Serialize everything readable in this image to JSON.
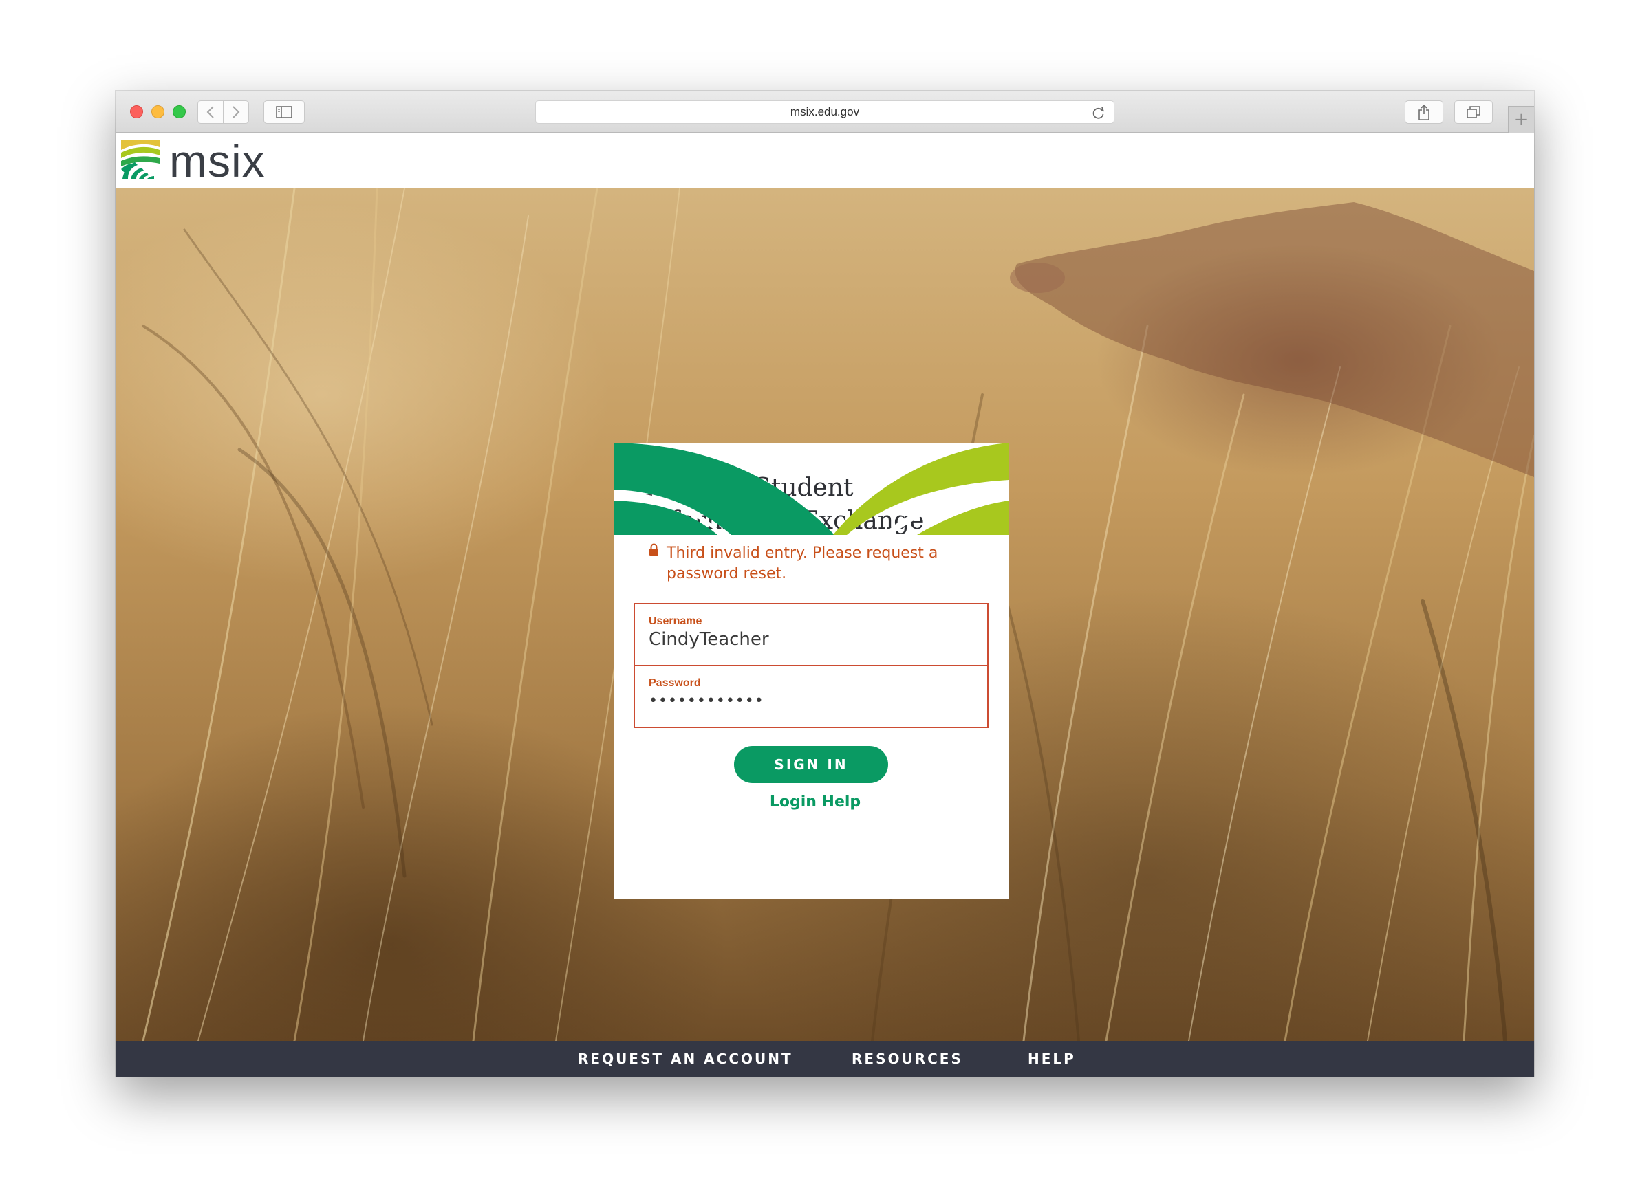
{
  "browser": {
    "url": "msix.edu.gov",
    "new_tab_symbol": "+"
  },
  "site": {
    "logo_text": "msix"
  },
  "login": {
    "title_line1": "Migrant Student",
    "title_line2": "Information Exchange",
    "error_line1": "Third invalid entry. Please request a",
    "error_line2": "password reset.",
    "username_label": "Username",
    "username_value": "CindyTeacher",
    "password_label": "Password",
    "password_value": "••••••••••••",
    "signin_label": "SIGN IN",
    "help_label": "Login Help"
  },
  "footer": {
    "request_account": "REQUEST AN ACCOUNT",
    "resources": "RESOURCES",
    "help": "HELP"
  },
  "colors": {
    "brand_green": "#0a9a63",
    "brand_lime": "#a8c81e",
    "error": "#c8501a",
    "footer_bg": "#343744"
  },
  "icons": [
    "close-window-icon",
    "minimize-window-icon",
    "zoom-window-icon",
    "back-icon",
    "forward-icon",
    "sidebar-icon",
    "reload-icon",
    "share-icon",
    "tabs-overview-icon",
    "lock-icon"
  ]
}
